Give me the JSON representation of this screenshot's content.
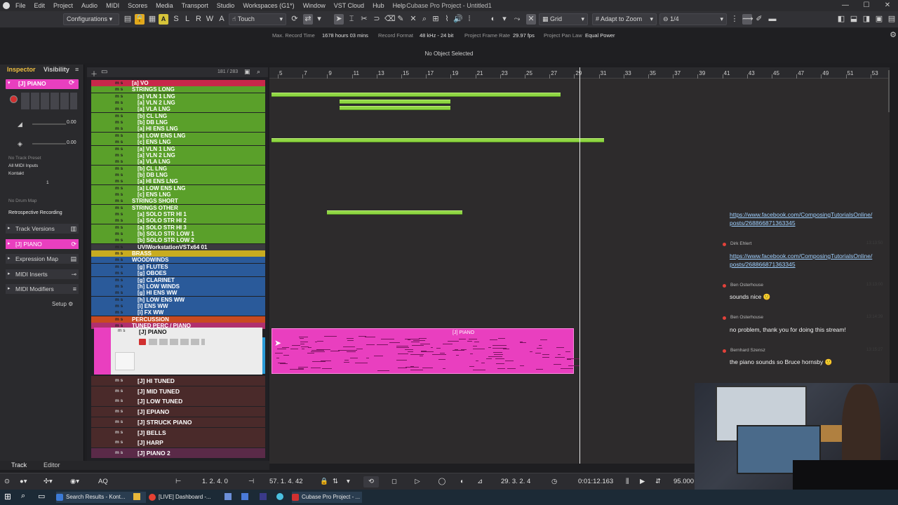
{
  "titlebar": {
    "menus": [
      "File",
      "Edit",
      "Project",
      "Audio",
      "MIDI",
      "Scores",
      "Media",
      "Transport",
      "Studio",
      "Workspaces (G1*)",
      "Window",
      "VST Cloud",
      "Hub",
      "Help"
    ],
    "title": "Cubase Pro Project - Untitled1",
    "min": "—",
    "max": "☐",
    "close": "✕"
  },
  "toolbar": {
    "configurations": "Configurations",
    "a_label": "A",
    "touch": "Touch",
    "grid": "Grid",
    "adapt_to_zoom": "Adapt to Zoom",
    "quantize": "1/4"
  },
  "infoline": {
    "max_record_time_label": "Max. Record Time",
    "max_record_time_value": "1678 hours 03 mins",
    "record_format_label": "Record Format",
    "record_format_value": "48 kHz - 24 bit",
    "frame_rate_label": "Project Frame Rate",
    "frame_rate_value": "29.97 fps",
    "pan_law_label": "Project Pan Law",
    "pan_law_value": "Equal Power",
    "status": "No Object Selected"
  },
  "inspector": {
    "tab_inspector": "Inspector",
    "tab_visibility": "Visibility",
    "track_name": "[J] PIANO",
    "vol_value": "0.00",
    "pan_value": "0.00",
    "no_track_preset": "No Track Preset",
    "midi_inputs": "All MIDI Inputs",
    "output": "Kontakt",
    "channel": "1",
    "no_drum_map": "No Drum Map",
    "retro_recording": "Retrospective Recording",
    "sections": [
      "Track Versions",
      "[J] PIANO",
      "Expression Map",
      "MIDI Inserts",
      "MIDI Modifiers"
    ],
    "setup": "Setup"
  },
  "tracklist": {
    "count": "181 / 283",
    "tracks": [
      {
        "name": "[a] VO",
        "color": "#c8284a",
        "group": true
      },
      {
        "name": "STRINGS LONG",
        "color": "#5aa02a",
        "group": true
      },
      {
        "name": "[a] VLN 1 LNG",
        "color": "#5aa02a"
      },
      {
        "name": "[a] VLN 2 LNG",
        "color": "#5aa02a"
      },
      {
        "name": "[a] VLA LNG",
        "color": "#5aa02a"
      },
      {
        "name": "[b] CL LNG",
        "color": "#5aa02a"
      },
      {
        "name": "[b] DB LNG",
        "color": "#5aa02a"
      },
      {
        "name": "[a] HI ENS LNG",
        "color": "#5aa02a"
      },
      {
        "name": "[a] LOW ENS LNG",
        "color": "#5aa02a"
      },
      {
        "name": "[c] ENS LNG",
        "color": "#5aa02a"
      },
      {
        "name": "[a] VLN 1 LNG",
        "color": "#5aa02a"
      },
      {
        "name": "[a] VLN 2 LNG",
        "color": "#5aa02a"
      },
      {
        "name": "[a] VLA LNG",
        "color": "#5aa02a"
      },
      {
        "name": "[b] CL LNG",
        "color": "#5aa02a"
      },
      {
        "name": "[b] DB LNG",
        "color": "#5aa02a"
      },
      {
        "name": "[a] HI ENS LNG",
        "color": "#5aa02a"
      },
      {
        "name": "[a] LOW ENS LNG",
        "color": "#5aa02a"
      },
      {
        "name": "[c] ENS LNG",
        "color": "#5aa02a"
      },
      {
        "name": "STRINGS SHORT",
        "color": "#5aa02a",
        "group": true
      },
      {
        "name": "STRINGS OTHER",
        "color": "#5aa02a",
        "group": true
      },
      {
        "name": "[a] SOLO STR HI 1",
        "color": "#5aa02a"
      },
      {
        "name": "[a] SOLO STR HI 2",
        "color": "#5aa02a"
      },
      {
        "name": "[a] SOLO STR HI 3",
        "color": "#5aa02a"
      },
      {
        "name": "[b] SOLO STR LOW 1",
        "color": "#5aa02a"
      },
      {
        "name": "[b] SOLO STR LOW 2",
        "color": "#5aa02a"
      },
      {
        "name": "UVIWorkstationVSTx64 01",
        "color": "#3a3a3e"
      },
      {
        "name": "BRASS",
        "color": "#c8ac20",
        "group": true
      },
      {
        "name": "WOODWINDS",
        "color": "#2a5a9a",
        "group": true
      },
      {
        "name": "[g] FLUTES",
        "color": "#2a5a9a"
      },
      {
        "name": "[g] OBOES",
        "color": "#2a5a9a"
      },
      {
        "name": "[g] CLARINET",
        "color": "#2a5a9a"
      },
      {
        "name": "[h] LOW WINDS",
        "color": "#2a5a9a"
      },
      {
        "name": "[g] HI ENS WW",
        "color": "#2a5a9a"
      },
      {
        "name": "[h] LOW ENS WW",
        "color": "#2a5a9a"
      },
      {
        "name": "[i] ENS WW",
        "color": "#2a5a9a"
      },
      {
        "name": "[i] FX WW",
        "color": "#2a5a9a"
      },
      {
        "name": "PERCUSSION",
        "color": "#c84a20",
        "group": true
      },
      {
        "name": "TUNED PERC / PIANO",
        "color": "#b0306e",
        "group": true
      }
    ],
    "selected_track": "[J] PIANO",
    "lower_tracks": [
      "[J] HI TUNED",
      "[J] MID TUNED",
      "[J] LOW TUNED",
      "[J] EPIANO",
      "[J] STRUCK PIANO",
      "[J] BELLS",
      "[J] HARP",
      "[J] PIANO 2"
    ]
  },
  "ruler": {
    "marks": [
      "5",
      "7",
      "9",
      "11",
      "13",
      "15",
      "17",
      "19",
      "21",
      "23",
      "25",
      "27",
      "29",
      "31",
      "33",
      "35",
      "37",
      "39",
      "41",
      "43",
      "45",
      "47",
      "49",
      "51",
      "53"
    ]
  },
  "piano_part_label": "[J] PIANO",
  "chat": [
    {
      "name": "",
      "msg": "https://www.facebook.com/ComposingTutorialsOnline/",
      "msg2": "posts/268866871363345",
      "link": true,
      "time": ""
    },
    {
      "name": "Dirk Ehlert",
      "msg": "https://www.facebook.com/ComposingTutorialsOnline/",
      "msg2": "posts/268866871363345",
      "link": true,
      "time": "13:13:50"
    },
    {
      "name": "Ben Osterhouse",
      "msg": "sounds nice 🙂",
      "time": "13:13:00"
    },
    {
      "name": "Ben Osterhouse",
      "msg": "no problem, thank you for doing this stream!",
      "time": "13:14:39"
    },
    {
      "name": "Bernhard Szensz",
      "msg": "the piano sounds so Bruce hornsby 🙂",
      "time": "13:15:27"
    }
  ],
  "bottom_tabs": {
    "track": "Track",
    "editor": "Editor"
  },
  "transport": {
    "left_locator": "1. 2. 4.  0",
    "right_locator": "57. 1. 4. 42",
    "position_bars": "29. 3. 2.  4",
    "position_time": "0:01:12.163",
    "tempo": "95.000"
  },
  "taskbar": {
    "items": [
      "Search Results - Kont...",
      "[LIVE] Dashboard -...",
      "Cubase Pro Project - ..."
    ]
  },
  "colors": {
    "strings": "#5aa02a",
    "winds": "#2a5a9a",
    "piano": "#e93fbf",
    "part_green": "#8fd643"
  }
}
